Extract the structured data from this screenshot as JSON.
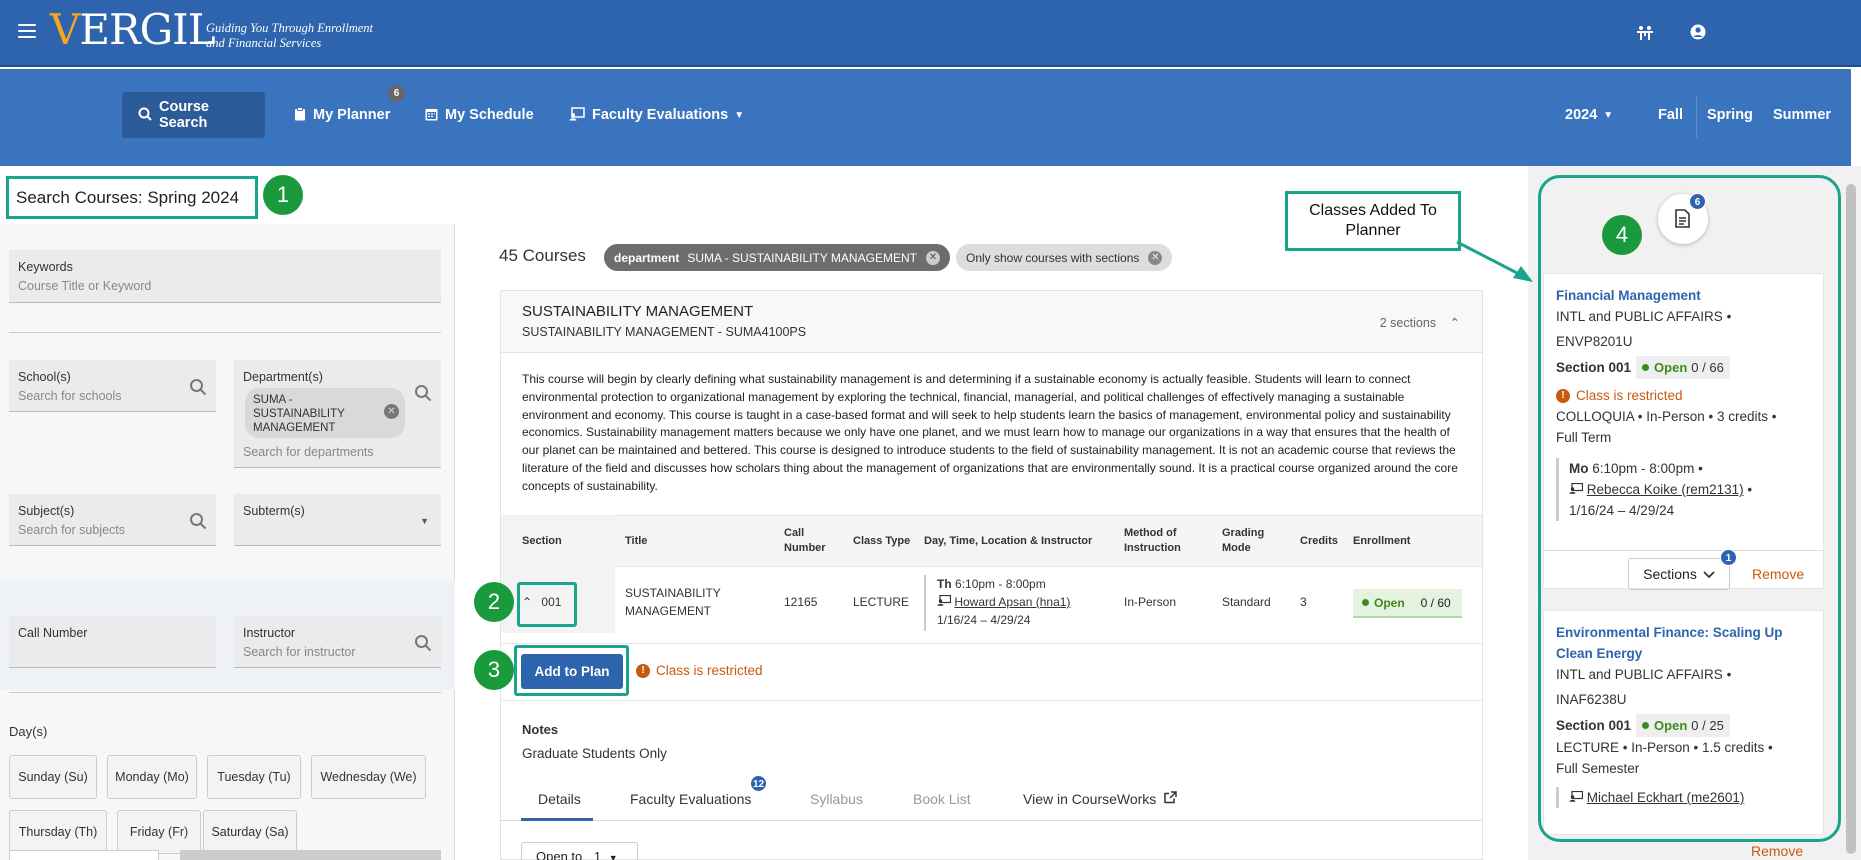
{
  "header": {
    "logo": "VERGIL",
    "tagline_line1": "Guiding You Through Enrollment",
    "tagline_line2": "and Financial Services",
    "icons": [
      "hamburger-icon",
      "accessibility-icon",
      "user-icon"
    ]
  },
  "nav": {
    "items": [
      {
        "label": "Course Search",
        "icon": "search-icon"
      },
      {
        "label": "My Planner",
        "icon": "clipboard-icon",
        "badge": "6"
      },
      {
        "label": "My Schedule",
        "icon": "calendar-icon"
      },
      {
        "label": "Faculty Evaluations",
        "icon": "evaluation-icon"
      }
    ],
    "year": "2024",
    "terms": [
      "Fall",
      "Spring",
      "Summer"
    ]
  },
  "page_title": "Search Courses: Spring 2024",
  "steps": [
    "1",
    "2",
    "3",
    "4"
  ],
  "filters": {
    "keywords_label": "Keywords",
    "keywords_placeholder": "Course Title or Keyword",
    "schools_label": "School(s)",
    "schools_placeholder": "Search for schools",
    "department_label": "Department(s)",
    "department_chip": "SUMA - SUSTAINABILITY MANAGEMENT",
    "department_placeholder": "Search for departments",
    "subjects_label": "Subject(s)",
    "subjects_placeholder": "Search for subjects",
    "subterm_label": "Subterm(s)",
    "call_number_label": "Call Number",
    "instructor_label": "Instructor",
    "instructor_placeholder": "Search for instructor",
    "days_label": "Day(s)",
    "days": [
      "Sunday (Su)",
      "Monday (Mo)",
      "Tuesday (Tu)",
      "Wednesday (We)",
      "Thursday (Th)",
      "Friday (Fr)",
      "Saturday (Sa)"
    ]
  },
  "results": {
    "count": "45 Courses",
    "chip_department_key": "department",
    "chip_department_value": "SUMA - SUSTAINABILITY MANAGEMENT",
    "chip_sections": "Only show courses with sections"
  },
  "course": {
    "title": "SUSTAINABILITY MANAGEMENT",
    "subtitle": "SUSTAINABILITY MANAGEMENT - SUMA4100PS",
    "sections_count": "2 sections",
    "description": "This course will begin by clearly defining what sustainability management is and determining if a sustainable economy is actually feasible. Students will learn to connect environmental protection to organizational management by exploring the technical, financial, managerial, and political challenges of effectively managing a sustainable environment and economy. This course is taught in a case-based format and will seek to help students learn the basics of management, environmental policy and sustainability economics. Sustainability management matters because we only have one planet, and we must learn how to manage our organizations in a way that ensures that the health of our planet can be maintained and bettered. This course is designed to introduce students to the field of sustainability management. It is not an academic course that reviews the literature of the field and discusses how scholars thing about the management of organizations that are environmentally sound. It is a practical course organized around the core concepts of sustainability.",
    "columns": [
      "Section",
      "Title",
      "Call Number",
      "Class Type",
      "Day, Time, Location & Instructor",
      "Method of Instruction",
      "Grading Mode",
      "Credits",
      "Enrollment"
    ],
    "section": {
      "number": "001",
      "title": "SUSTAINABILITY MANAGEMENT",
      "call_number": "12165",
      "class_type": "LECTURE",
      "day": "Th",
      "time": "6:10pm - 8:00pm",
      "instructor": "Howard Apsan (hna1)",
      "dates": "1/16/24 – 4/29/24",
      "method": "In-Person",
      "grading": "Standard",
      "credits": "3",
      "status": "Open",
      "enrollment": "0 / 60"
    },
    "add_button": "Add to Plan",
    "restricted": "Class is restricted",
    "notes_label": "Notes",
    "notes_text": "Graduate Students Only",
    "tabs": [
      {
        "label": "Details"
      },
      {
        "label": "Faculty Evaluations",
        "badge": "12"
      },
      {
        "label": "Syllabus"
      },
      {
        "label": "Book List"
      },
      {
        "label": "View in CourseWorks"
      }
    ],
    "open_to_label": "Open to",
    "open_to_value": "1"
  },
  "planner": {
    "callout": "Classes Added To Planner",
    "badge": "6",
    "items": [
      {
        "title": "Financial Management",
        "school": "INTL and PUBLIC AFFAIRS •",
        "code": "ENVP8201U",
        "section": "Section 001",
        "status": "Open",
        "enrollment": "0 / 66",
        "restricted": "Class is restricted",
        "type_line": "COLLOQUIA • In-Person • 3 credits •",
        "term": "Full Term",
        "day": "Mo",
        "time": "6:10pm - 8:00pm •",
        "instructor": "Rebecca Koike (rem2131)",
        "dates": "1/16/24 – 4/29/24",
        "sections_button": "Sections",
        "sections_badge": "1",
        "remove": "Remove"
      },
      {
        "title_line1": "Environmental Finance: Scaling Up",
        "title_line2": "Clean Energy",
        "school": "INTL and PUBLIC AFFAIRS •",
        "code": "INAF6238U",
        "section": "Section 001",
        "status": "Open",
        "enrollment": "0 / 25",
        "type_line": "LECTURE • In-Person • 1.5 credits •",
        "term": "Full Semester",
        "instructor": "Michael Eckhart (me2601)",
        "remove": "Remove"
      }
    ]
  },
  "colors": {
    "topbar": "#2d64ad",
    "navbar": "#3a74bf",
    "annotation": "#1aa58a",
    "step_circle": "#1a9a3d",
    "restricted": "#c8590d",
    "open": "#3f8a1e"
  }
}
